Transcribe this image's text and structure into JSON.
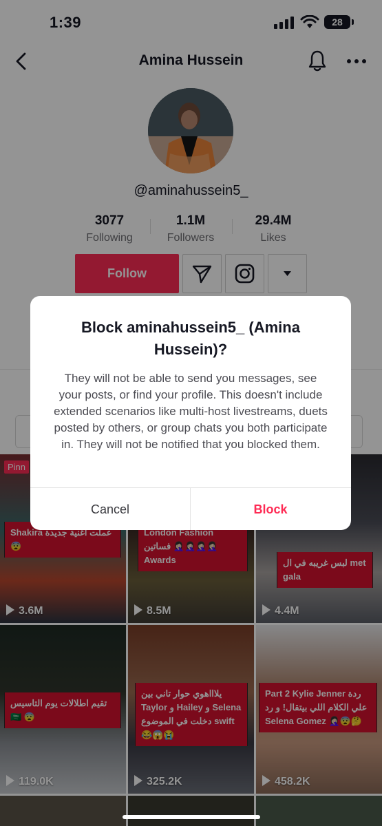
{
  "status_bar": {
    "time": "1:39",
    "battery": "28"
  },
  "header": {
    "title": "Amina Hussein"
  },
  "profile": {
    "username": "@aminahussein5_",
    "stats": [
      {
        "value": "3077",
        "label": "Following"
      },
      {
        "value": "1.1M",
        "label": "Followers"
      },
      {
        "value": "29.4M",
        "label": "Likes"
      }
    ],
    "follow_label": "Follow"
  },
  "videos": [
    {
      "views": "3.6M",
      "caption": "Shakira عملت اغنية جديدة 😨",
      "pinned": "Pinn"
    },
    {
      "views": "8.5M",
      "caption": "London Fashion فساتين 🤦🏻‍♀️🤦🏻‍♀️🤦🏻‍♀️🤦🏻‍♀️ Awards"
    },
    {
      "views": "4.4M",
      "caption": "لبس غريبه في ال met gala"
    },
    {
      "views": "119.0K",
      "caption": "تقيم اطلالات يوم التاسيس 🇸🇦 😨"
    },
    {
      "views": "325.2K",
      "caption": "يلاااهوي حوار تاني بين Taylor و Hailey و Selena دخلت في الموضوع swift 😂😱😭"
    },
    {
      "views": "458.2K",
      "caption": "Part 2 Kylie Jenner ردة علي الكلام اللي بيتقال! و رد Selena Gomez 🤦🏻‍♀️😨🤔"
    }
  ],
  "dialog": {
    "title": "Block aminahussein5_ (Amina Hussein)?",
    "body": "They will not be able to send you messages, see your posts, or find your profile. This doesn't include extended scenarios like multi-host livestreams, duets posted by others, or group chats you both participate in. They will not be notified that you blocked them.",
    "cancel_label": "Cancel",
    "confirm_label": "Block"
  },
  "colors": {
    "accent": "#fe2c55",
    "caption_bg": "#d5122f"
  }
}
